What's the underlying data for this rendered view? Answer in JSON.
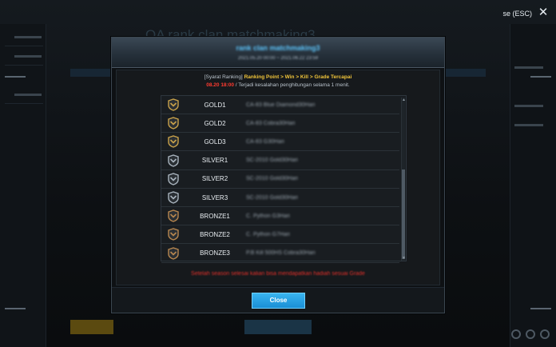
{
  "window": {
    "esc_hint": "se (ESC)"
  },
  "modal": {
    "title": "rank clan matchmaking3",
    "dates": "2021.05.20 00:00 ~ 2021.06.22 23:59",
    "info": {
      "prefix": "[Syarat Ranking]",
      "criteria": "Ranking Point > Win > Kill > Grade Tercapai",
      "time": "08.20 18:00",
      "notice": "/ Terjadi kesalahan penghitungan selama 1 menit."
    },
    "grades": [
      {
        "name": "GOLD1",
        "reward": "CA-83 Blue Diamond30Hari",
        "tier": "gold"
      },
      {
        "name": "GOLD2",
        "reward": "CA-83 Cobra30Hari",
        "tier": "gold"
      },
      {
        "name": "GOLD3",
        "reward": "CA-83 G30Hari",
        "tier": "gold"
      },
      {
        "name": "SILVER1",
        "reward": "SC-2010 Gold30Hari",
        "tier": "silver"
      },
      {
        "name": "SILVER2",
        "reward": "SC-2010 Gold30Hari",
        "tier": "silver"
      },
      {
        "name": "SILVER3",
        "reward": "SC-2010 Gold30Hari",
        "tier": "silver"
      },
      {
        "name": "BRONZE1",
        "reward": "C. Python G3Hari",
        "tier": "bronze"
      },
      {
        "name": "BRONZE2",
        "reward": "C. Python G7Hari",
        "tier": "bronze"
      },
      {
        "name": "BRONZE3",
        "reward": "P.B Kill 500HS Cobra30Hari",
        "tier": "bronze"
      }
    ],
    "footer_note": "Setelah season selesai kalian bisa mendapatkan hadiah sesuai Grade",
    "close_label": "Close"
  },
  "colors": {
    "gold": "#c9a24a",
    "silver": "#a9b4be",
    "bronze": "#b8874f",
    "accent": "#2aa4e6",
    "warning": "#e0302a"
  },
  "background": {
    "title": "OA rank clan matchmaking3"
  }
}
